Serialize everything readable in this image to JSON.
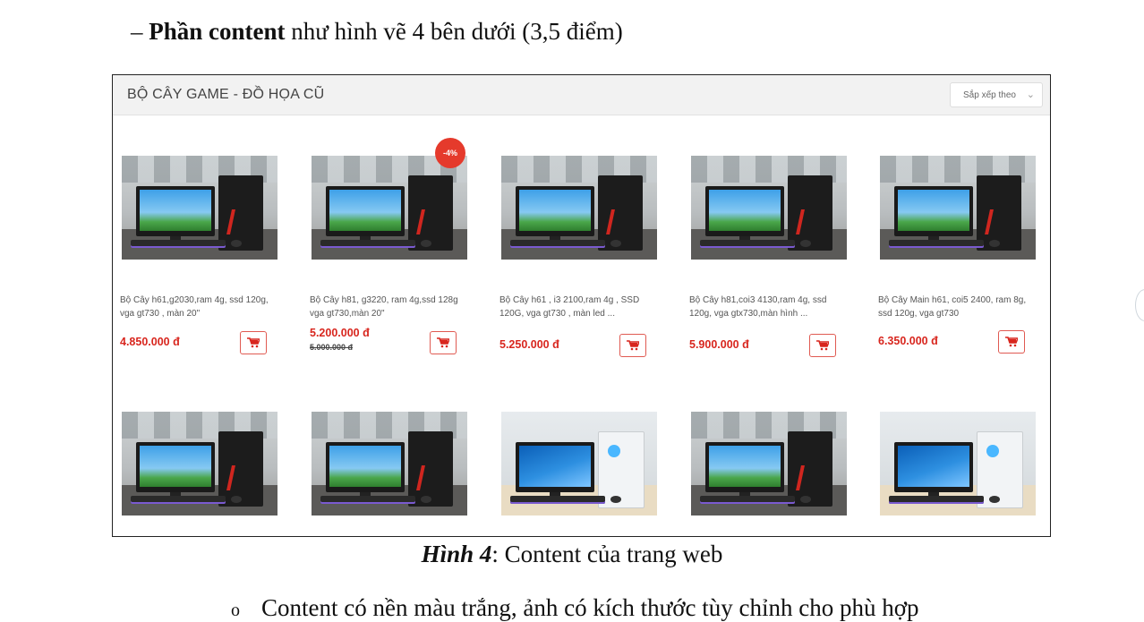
{
  "heading": {
    "prefix": "– ",
    "bold": "Phần content",
    "rest": " như hình vẽ 4 bên dưới (3,5 điểm)"
  },
  "figure": {
    "title": "BỘ CÂY GAME - ĐỒ HỌA CŨ",
    "sort_label": "Sắp xếp theo",
    "row1": [
      {
        "name": "Bộ Cây h61,g2030,ram 4g, ssd 120g, vga gt730 , màn 20\"",
        "price": "4.850.000 đ",
        "old_price": "",
        "badge": ""
      },
      {
        "name": "Bộ Cây h81, g3220, ram 4g,ssd 128g vga gt730,màn 20\"",
        "price": "5.200.000 đ",
        "old_price": "5.000.000 đ",
        "badge": "-4%"
      },
      {
        "name": "Bộ Cây h61 , i3 2100,ram 4g , SSD 120G, vga gt730 , màn led ...",
        "price": "5.250.000 đ",
        "old_price": "",
        "badge": ""
      },
      {
        "name": "Bộ Cây h81,coi3 4130,ram 4g, ssd 120g, vga gtx730,màn hình ...",
        "price": "5.900.000 đ",
        "old_price": "",
        "badge": ""
      },
      {
        "name": "Bộ Cây Main h61, coi5 2400, ram 8g, ssd 120g, vga gt730",
        "price": "6.350.000 đ",
        "old_price": "",
        "badge": ""
      }
    ]
  },
  "caption": {
    "bold": "Hình 4",
    "rest": ": Content của trang web"
  },
  "bullet": {
    "symbol": "o",
    "text": "Content có nền màu trắng, ảnh có kích thước tùy chỉnh cho phù hợp"
  },
  "colors": {
    "price_red": "#d8261e",
    "badge_red": "#e53a2c",
    "header_gray": "#f2f2f2"
  },
  "icons": {
    "cart": "shopping-cart-icon",
    "dropdown": "chevron-down-icon"
  }
}
